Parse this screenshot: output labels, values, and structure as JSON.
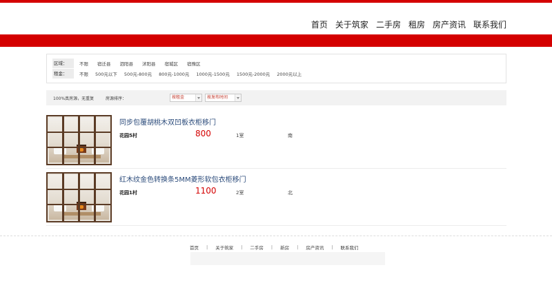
{
  "nav": {
    "items": [
      "首页",
      "关于筑家",
      "二手房",
      "租房",
      "房产资讯",
      "联系我们"
    ]
  },
  "filters": {
    "area_label": "区域：",
    "area_options": [
      "不限",
      "宿迁县",
      "泗阳县",
      "沭阳县",
      "宿城区",
      "宿豫区"
    ],
    "rent_label": "租金：",
    "rent_options": [
      "不限",
      "500元以下",
      "500元-800元",
      "800元-1000元",
      "1000元-1500元",
      "1500元-2000元",
      "2000元以上"
    ]
  },
  "sort": {
    "note": "100%真房源，无重复",
    "label": "房源排序：",
    "select1": "按租金",
    "select2": "按发布时间"
  },
  "listings": [
    {
      "title": "同步包覆胡桃木双凹板衣柜移门",
      "estate": "花园5村",
      "price": "800",
      "rooms": "1室",
      "orientation": "南"
    },
    {
      "title": "红木纹金色转换条5MM菱形软包衣柜移门",
      "estate": "花园1村",
      "price": "1100",
      "rooms": "2室",
      "orientation": "北"
    }
  ],
  "footer": {
    "links": [
      "首页",
      "关于筑家",
      "二手房",
      "新房",
      "房产资讯",
      "联系我们"
    ]
  },
  "colors": {
    "brand_red": "#d40000",
    "title_blue": "#2a4a7a"
  }
}
